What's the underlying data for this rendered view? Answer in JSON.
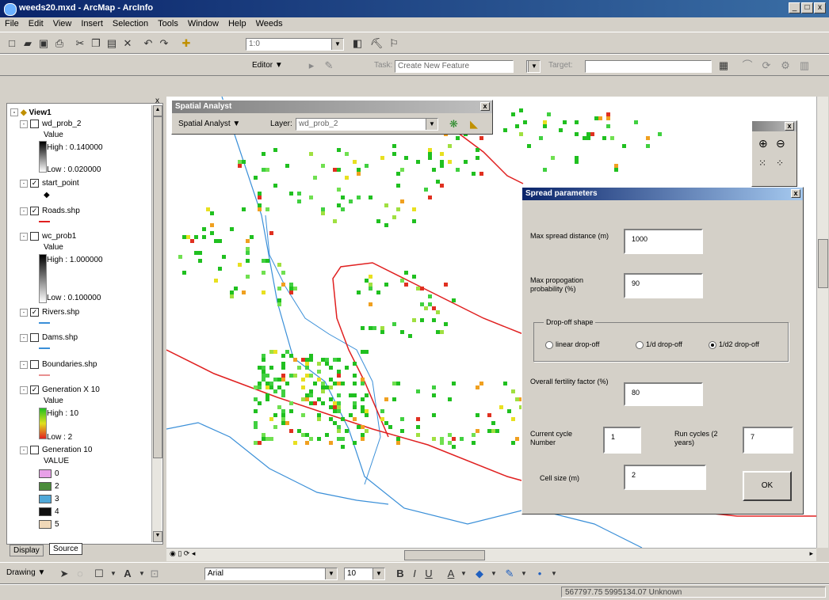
{
  "window": {
    "title": "weeds20.mxd - ArcMap - ArcInfo",
    "min": "_",
    "max": "□",
    "close": "x"
  },
  "menu": [
    "File",
    "Edit",
    "View",
    "Insert",
    "Selection",
    "Tools",
    "Window",
    "Help",
    "Weeds"
  ],
  "toolbar1": {
    "scale_value": "1:0"
  },
  "toolbar2": {
    "editor_label": "Editor ▼",
    "task_label": "Task:",
    "task_value": "Create New Feature",
    "target_label": "Target:",
    "target_value": ""
  },
  "toc": {
    "root": "View1",
    "layers": [
      {
        "name": "wd_prob_2",
        "checked": false,
        "sub": [
          "Value",
          "High : 0.140000",
          "Low : 0.020000"
        ]
      },
      {
        "name": "start_point",
        "checked": true
      },
      {
        "name": "Roads.shp",
        "checked": true
      },
      {
        "name": "wc_prob1",
        "checked": false,
        "sub": [
          "Value",
          "High : 1.000000",
          "Low : 0.100000"
        ]
      },
      {
        "name": "Rivers.shp",
        "checked": true
      },
      {
        "name": "Dams.shp",
        "checked": false
      },
      {
        "name": "Boundaries.shp",
        "checked": false
      },
      {
        "name": "Generation X 10",
        "checked": true,
        "sub": [
          "Value",
          "High : 10",
          "Low : 2"
        ]
      },
      {
        "name": "Generation  10",
        "checked": false,
        "sub": [
          "VALUE"
        ]
      }
    ],
    "value_classes": [
      "0",
      "2",
      "3",
      "4",
      "5"
    ],
    "class_colors": [
      "#e8a0e8",
      "#4a8c3a",
      "#4fa8d8",
      "#101010",
      "#f0d8b8"
    ],
    "tab_display": "Display",
    "tab_source": "Source"
  },
  "spatial_analyst": {
    "title": "Spatial Analyst",
    "menu_label": "Spatial Analyst ▼",
    "layer_label": "Layer:",
    "layer_value": "wd_prob_2"
  },
  "dialog": {
    "title": "Spread parameters",
    "max_spread_label": "Max spread distance (m)",
    "max_spread_value": "1000",
    "max_prop_label": "Max propogation probability (%)",
    "max_prop_value": "90",
    "dropoff_group": "Drop-off shape",
    "dropoff_options": [
      "linear drop-off",
      "1/d drop-off",
      "1/d2 drop-off"
    ],
    "dropoff_selected": 2,
    "fertility_label": "Overall fertility factor (%)",
    "fertility_value": "80",
    "cycle_label": "Current cycle Number",
    "cycle_value": "1",
    "run_label": "Run cycles (2 years)",
    "run_value": "7",
    "cell_label": "Cell size (m)",
    "cell_value": "2",
    "ok_label": "OK"
  },
  "drawing": {
    "label": "Drawing ▼",
    "font_value": "Arial",
    "size_value": "10"
  },
  "status": {
    "coords": "567797.75  5995134.07 Unknown"
  },
  "colors": {
    "roads": "#e02020",
    "rivers": "#3a8fd8",
    "title_active": "#0a246a"
  }
}
